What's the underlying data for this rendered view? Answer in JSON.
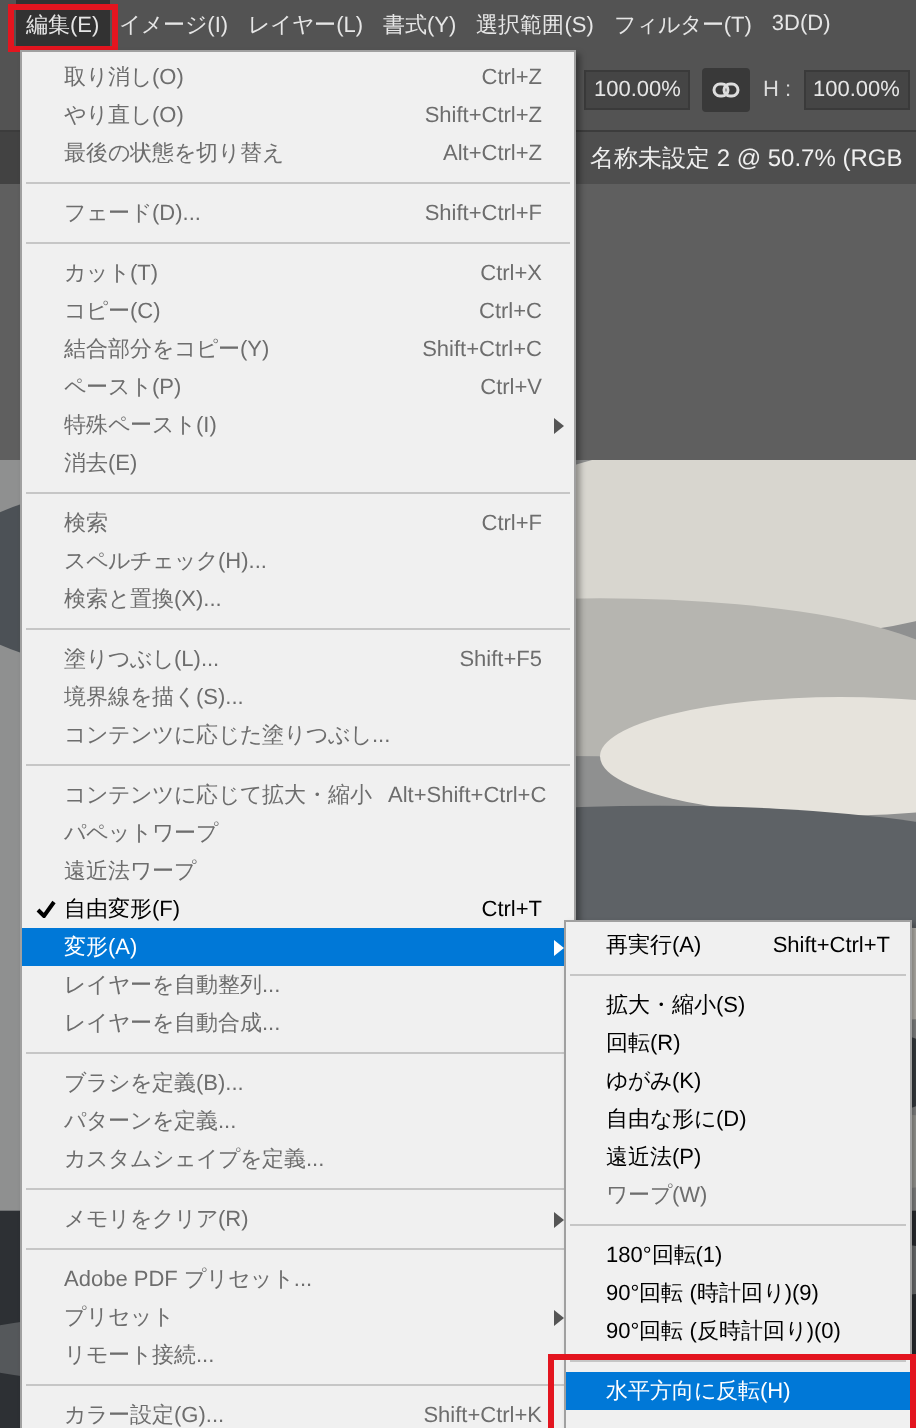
{
  "menu_bar": [
    {
      "label": "編集(E)",
      "selected": true,
      "highlight": true
    },
    {
      "label": "イメージ(I)",
      "selected": false,
      "highlight": false
    },
    {
      "label": "レイヤー(L)",
      "selected": false,
      "highlight": false
    },
    {
      "label": "書式(Y)",
      "selected": false,
      "highlight": false
    },
    {
      "label": "選択範囲(S)",
      "selected": false,
      "highlight": false
    },
    {
      "label": "フィルター(T)",
      "selected": false,
      "highlight": false
    },
    {
      "label": "3D(D)",
      "selected": false,
      "highlight": false
    }
  ],
  "options_bar": {
    "width_value": "100.00%",
    "height_label": "H :",
    "height_value": "100.00%"
  },
  "document_tab": {
    "title": "名称未設定 2 @ 50.7% (RGB"
  },
  "edit_menu": [
    {
      "kind": "item",
      "label": "取り消し(O)",
      "shortcut": "Ctrl+Z",
      "disabled": true,
      "checked": false,
      "selected": false,
      "submenu": false
    },
    {
      "kind": "item",
      "label": "やり直し(O)",
      "shortcut": "Shift+Ctrl+Z",
      "disabled": true,
      "checked": false,
      "selected": false,
      "submenu": false
    },
    {
      "kind": "item",
      "label": "最後の状態を切り替え",
      "shortcut": "Alt+Ctrl+Z",
      "disabled": true,
      "checked": false,
      "selected": false,
      "submenu": false
    },
    {
      "kind": "separator"
    },
    {
      "kind": "item",
      "label": "フェード(D)...",
      "shortcut": "Shift+Ctrl+F",
      "disabled": true,
      "checked": false,
      "selected": false,
      "submenu": false
    },
    {
      "kind": "separator"
    },
    {
      "kind": "item",
      "label": "カット(T)",
      "shortcut": "Ctrl+X",
      "disabled": true,
      "checked": false,
      "selected": false,
      "submenu": false
    },
    {
      "kind": "item",
      "label": "コピー(C)",
      "shortcut": "Ctrl+C",
      "disabled": true,
      "checked": false,
      "selected": false,
      "submenu": false
    },
    {
      "kind": "item",
      "label": "結合部分をコピー(Y)",
      "shortcut": "Shift+Ctrl+C",
      "disabled": true,
      "checked": false,
      "selected": false,
      "submenu": false
    },
    {
      "kind": "item",
      "label": "ペースト(P)",
      "shortcut": "Ctrl+V",
      "disabled": true,
      "checked": false,
      "selected": false,
      "submenu": false
    },
    {
      "kind": "item",
      "label": "特殊ペースト(I)",
      "disabled": true,
      "checked": false,
      "selected": false,
      "submenu": true
    },
    {
      "kind": "item",
      "label": "消去(E)",
      "disabled": true,
      "checked": false,
      "selected": false,
      "submenu": false
    },
    {
      "kind": "separator"
    },
    {
      "kind": "item",
      "label": "検索",
      "shortcut": "Ctrl+F",
      "disabled": true,
      "checked": false,
      "selected": false,
      "submenu": false
    },
    {
      "kind": "item",
      "label": "スペルチェック(H)...",
      "disabled": true,
      "checked": false,
      "selected": false,
      "submenu": false
    },
    {
      "kind": "item",
      "label": "検索と置換(X)...",
      "disabled": true,
      "checked": false,
      "selected": false,
      "submenu": false
    },
    {
      "kind": "separator"
    },
    {
      "kind": "item",
      "label": "塗りつぶし(L)...",
      "shortcut": "Shift+F5",
      "disabled": true,
      "checked": false,
      "selected": false,
      "submenu": false
    },
    {
      "kind": "item",
      "label": "境界線を描く(S)...",
      "disabled": true,
      "checked": false,
      "selected": false,
      "submenu": false
    },
    {
      "kind": "item",
      "label": "コンテンツに応じた塗りつぶし...",
      "disabled": true,
      "checked": false,
      "selected": false,
      "submenu": false
    },
    {
      "kind": "separator"
    },
    {
      "kind": "item",
      "label": "コンテンツに応じて拡大・縮小",
      "shortcut": "Alt+Shift+Ctrl+C",
      "disabled": true,
      "checked": false,
      "selected": false,
      "submenu": false
    },
    {
      "kind": "item",
      "label": "パペットワープ",
      "disabled": true,
      "checked": false,
      "selected": false,
      "submenu": false
    },
    {
      "kind": "item",
      "label": "遠近法ワープ",
      "disabled": true,
      "checked": false,
      "selected": false,
      "submenu": false
    },
    {
      "kind": "item",
      "label": "自由変形(F)",
      "shortcut": "Ctrl+T",
      "disabled": false,
      "checked": true,
      "selected": false,
      "submenu": false
    },
    {
      "kind": "item",
      "label": "変形(A)",
      "disabled": false,
      "checked": false,
      "selected": true,
      "submenu": true
    },
    {
      "kind": "item",
      "label": "レイヤーを自動整列...",
      "disabled": true,
      "checked": false,
      "selected": false,
      "submenu": false
    },
    {
      "kind": "item",
      "label": "レイヤーを自動合成...",
      "disabled": true,
      "checked": false,
      "selected": false,
      "submenu": false
    },
    {
      "kind": "separator"
    },
    {
      "kind": "item",
      "label": "ブラシを定義(B)...",
      "disabled": true,
      "checked": false,
      "selected": false,
      "submenu": false
    },
    {
      "kind": "item",
      "label": "パターンを定義...",
      "disabled": true,
      "checked": false,
      "selected": false,
      "submenu": false
    },
    {
      "kind": "item",
      "label": "カスタムシェイプを定義...",
      "disabled": true,
      "checked": false,
      "selected": false,
      "submenu": false
    },
    {
      "kind": "separator"
    },
    {
      "kind": "item",
      "label": "メモリをクリア(R)",
      "disabled": true,
      "checked": false,
      "selected": false,
      "submenu": true
    },
    {
      "kind": "separator"
    },
    {
      "kind": "item",
      "label": "Adobe PDF プリセット...",
      "disabled": true,
      "checked": false,
      "selected": false,
      "submenu": false
    },
    {
      "kind": "item",
      "label": "プリセット",
      "disabled": true,
      "checked": false,
      "selected": false,
      "submenu": true
    },
    {
      "kind": "item",
      "label": "リモート接続...",
      "disabled": true,
      "checked": false,
      "selected": false,
      "submenu": false
    },
    {
      "kind": "separator"
    },
    {
      "kind": "item",
      "label": "カラー設定(G)...",
      "shortcut": "Shift+Ctrl+K",
      "disabled": true,
      "checked": false,
      "selected": false,
      "submenu": false
    }
  ],
  "transform_submenu": [
    {
      "kind": "item",
      "label": "再実行(A)",
      "shortcut": "Shift+Ctrl+T",
      "disabled": false,
      "checked": false,
      "selected": false,
      "submenu": false,
      "highlight": false
    },
    {
      "kind": "separator"
    },
    {
      "kind": "item",
      "label": "拡大・縮小(S)",
      "disabled": false,
      "checked": false,
      "selected": false,
      "submenu": false,
      "highlight": false
    },
    {
      "kind": "item",
      "label": "回転(R)",
      "disabled": false,
      "checked": false,
      "selected": false,
      "submenu": false,
      "highlight": false
    },
    {
      "kind": "item",
      "label": "ゆがみ(K)",
      "disabled": false,
      "checked": false,
      "selected": false,
      "submenu": false,
      "highlight": false
    },
    {
      "kind": "item",
      "label": "自由な形に(D)",
      "disabled": false,
      "checked": false,
      "selected": false,
      "submenu": false,
      "highlight": false
    },
    {
      "kind": "item",
      "label": "遠近法(P)",
      "disabled": false,
      "checked": false,
      "selected": false,
      "submenu": false,
      "highlight": false
    },
    {
      "kind": "item",
      "label": "ワープ(W)",
      "disabled": true,
      "checked": false,
      "selected": false,
      "submenu": false,
      "highlight": false
    },
    {
      "kind": "separator"
    },
    {
      "kind": "item",
      "label": "180°回転(1)",
      "disabled": false,
      "checked": false,
      "selected": false,
      "submenu": false,
      "highlight": false
    },
    {
      "kind": "item",
      "label": "90°回転 (時計回り)(9)",
      "disabled": false,
      "checked": false,
      "selected": false,
      "submenu": false,
      "highlight": false
    },
    {
      "kind": "item",
      "label": "90°回転 (反時計回り)(0)",
      "disabled": false,
      "checked": false,
      "selected": false,
      "submenu": false,
      "highlight": false
    },
    {
      "kind": "separator"
    },
    {
      "kind": "item",
      "label": "水平方向に反転(H)",
      "disabled": false,
      "checked": false,
      "selected": true,
      "submenu": false,
      "highlight": true
    }
  ]
}
